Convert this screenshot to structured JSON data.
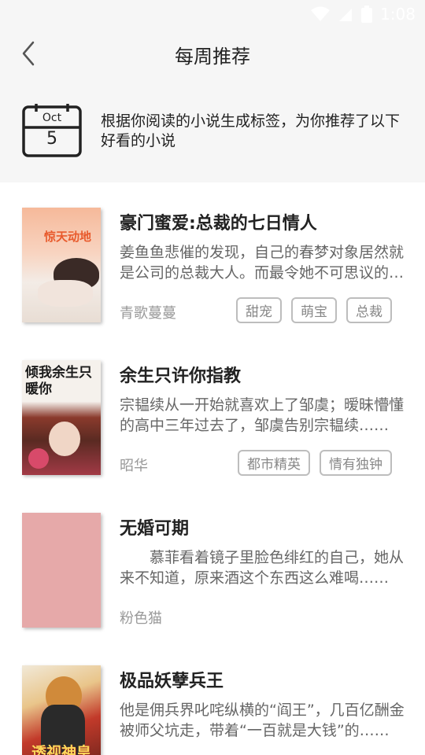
{
  "status_bar": {
    "time": "1:08"
  },
  "header": {
    "title": "每周推荐"
  },
  "intro": {
    "calendar_month": "Oct",
    "calendar_day": "5",
    "text": "根据你阅读的小说生成标签，为你推荐了以下好看的小说"
  },
  "books": [
    {
      "title": "豪门蜜爱:总裁的七日情人",
      "description": "姜鱼鱼悲催的发现，自己的春梦对象居然就是公司的总裁大人。而最令她不可思议的是……",
      "author": "青歌蔓蔓",
      "tags": [
        "甜宠",
        "萌宝",
        "总裁"
      ],
      "cover_text": "惊天动地"
    },
    {
      "title": "余生只许你指教",
      "description": "宗韫续从一开始就喜欢上了邹虞；暧昧懵懂的高中三年过去了，邹虞告别宗韫续……",
      "author": "昭华",
      "tags": [
        "都市精英",
        "情有独钟"
      ],
      "cover_text": "倾我余生只暖你"
    },
    {
      "title": "无婚可期",
      "description": "　　慕菲看着镜子里脸色绯红的自己，她从来不知道，原来酒这个东西这么难喝……",
      "author": "粉色猫",
      "tags": []
    },
    {
      "title": "极品妖孽兵王",
      "description": "他是佣兵界叱咤纵横的“阎王”，几百亿酬金被师父坑走，带着“一百就是大钱”的……",
      "author": "",
      "tags": [],
      "cover_text": "透视神皇"
    }
  ]
}
